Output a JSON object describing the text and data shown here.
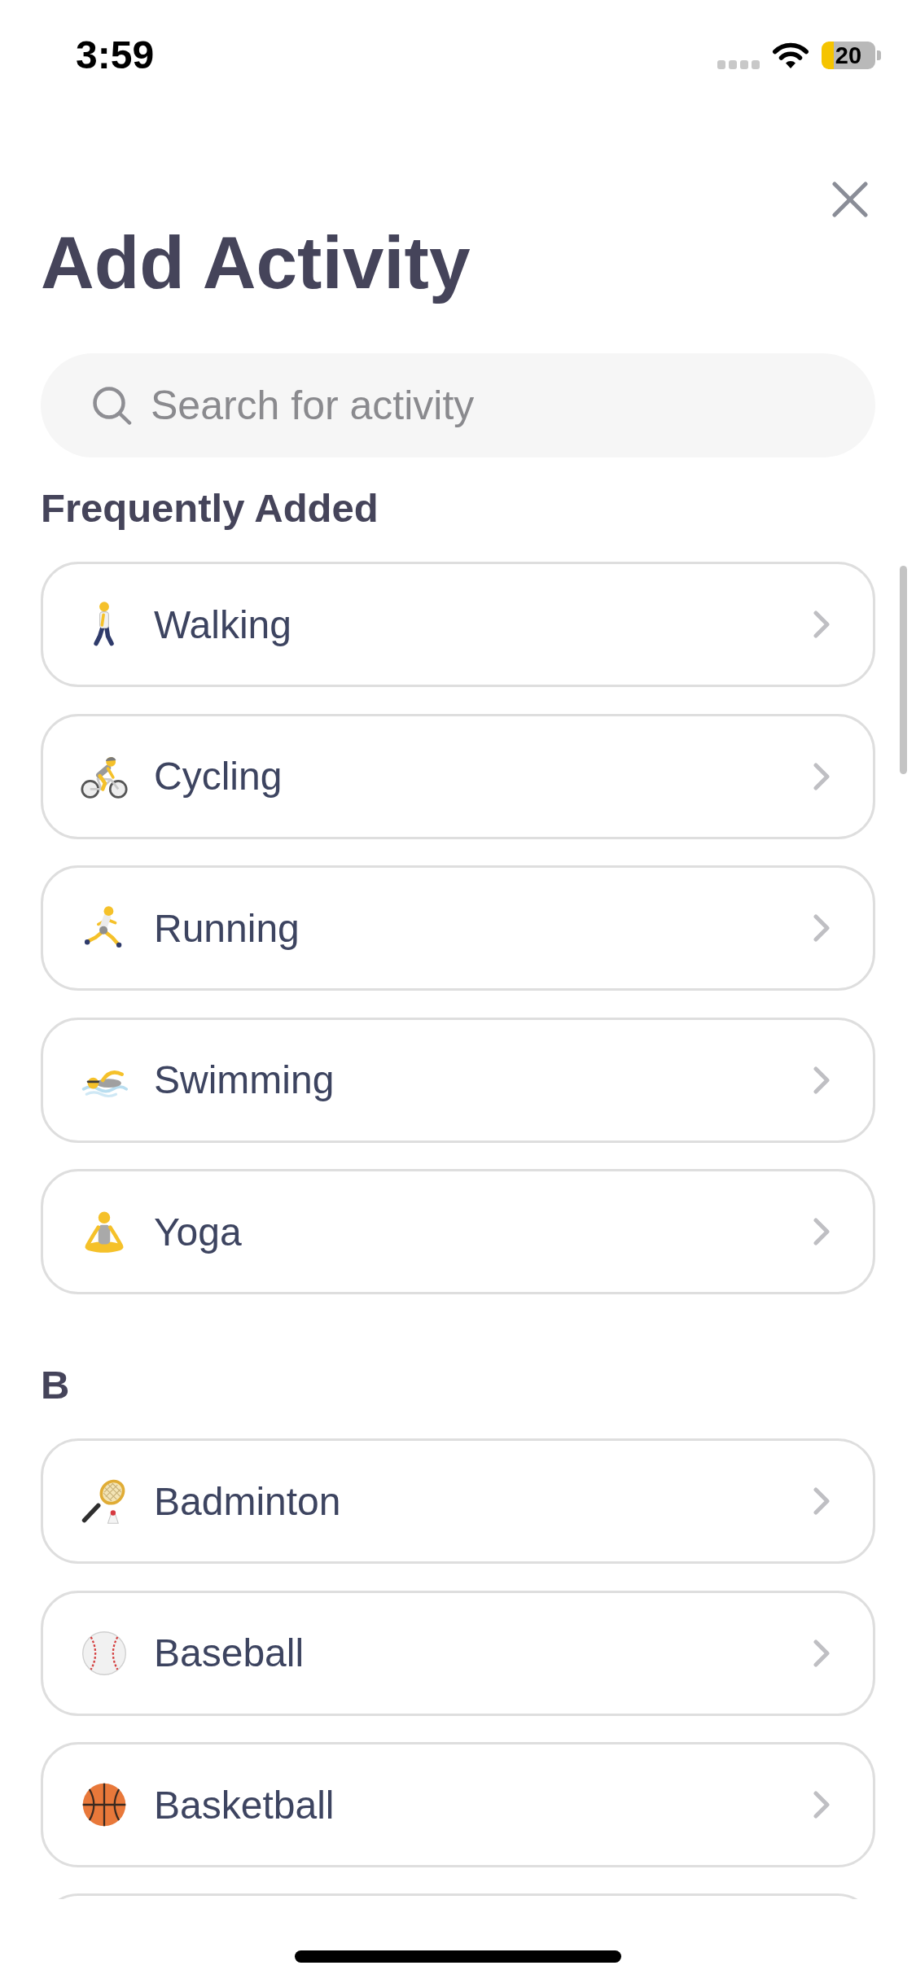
{
  "status_bar": {
    "time": "3:59",
    "battery": "20"
  },
  "header": {
    "title": "Add Activity"
  },
  "search": {
    "placeholder": "Search for activity"
  },
  "sections": [
    {
      "title": "Frequently Added",
      "items": [
        {
          "label": "Walking",
          "kind": "walker"
        },
        {
          "label": "Cycling",
          "kind": "cyclist"
        },
        {
          "label": "Running",
          "kind": "runner"
        },
        {
          "label": "Swimming",
          "kind": "swimmer"
        },
        {
          "label": "Yoga",
          "kind": "meditator"
        }
      ]
    },
    {
      "title": "B",
      "items": [
        {
          "label": "Badminton",
          "kind": "racket"
        },
        {
          "label": "Baseball",
          "kind": "baseball"
        },
        {
          "label": "Basketball",
          "kind": "basketball"
        }
      ]
    }
  ]
}
